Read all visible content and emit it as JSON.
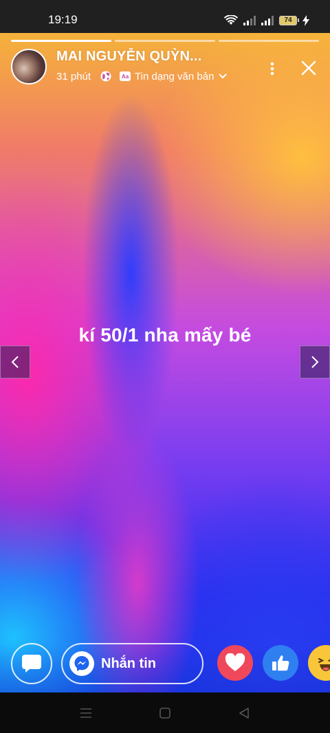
{
  "status_bar": {
    "time": "19:19",
    "battery_level": "74"
  },
  "story": {
    "progress_segments": 3,
    "active_segment": 1,
    "user_name": "MAI NGUYỄN QUỲN...",
    "time_ago": "31 phút",
    "privacy_icon": "globe-icon",
    "story_type": "Tin dạng văn bản",
    "text": "kí 50/1 nha mấy bé"
  },
  "actions": {
    "message_label": "Nhắn tin",
    "reactions": [
      "love",
      "like",
      "haha"
    ]
  },
  "colors": {
    "love": "#f0485b",
    "like": "#2f7ff0",
    "haha": "#f9c63a",
    "status_bar": "#202020"
  }
}
